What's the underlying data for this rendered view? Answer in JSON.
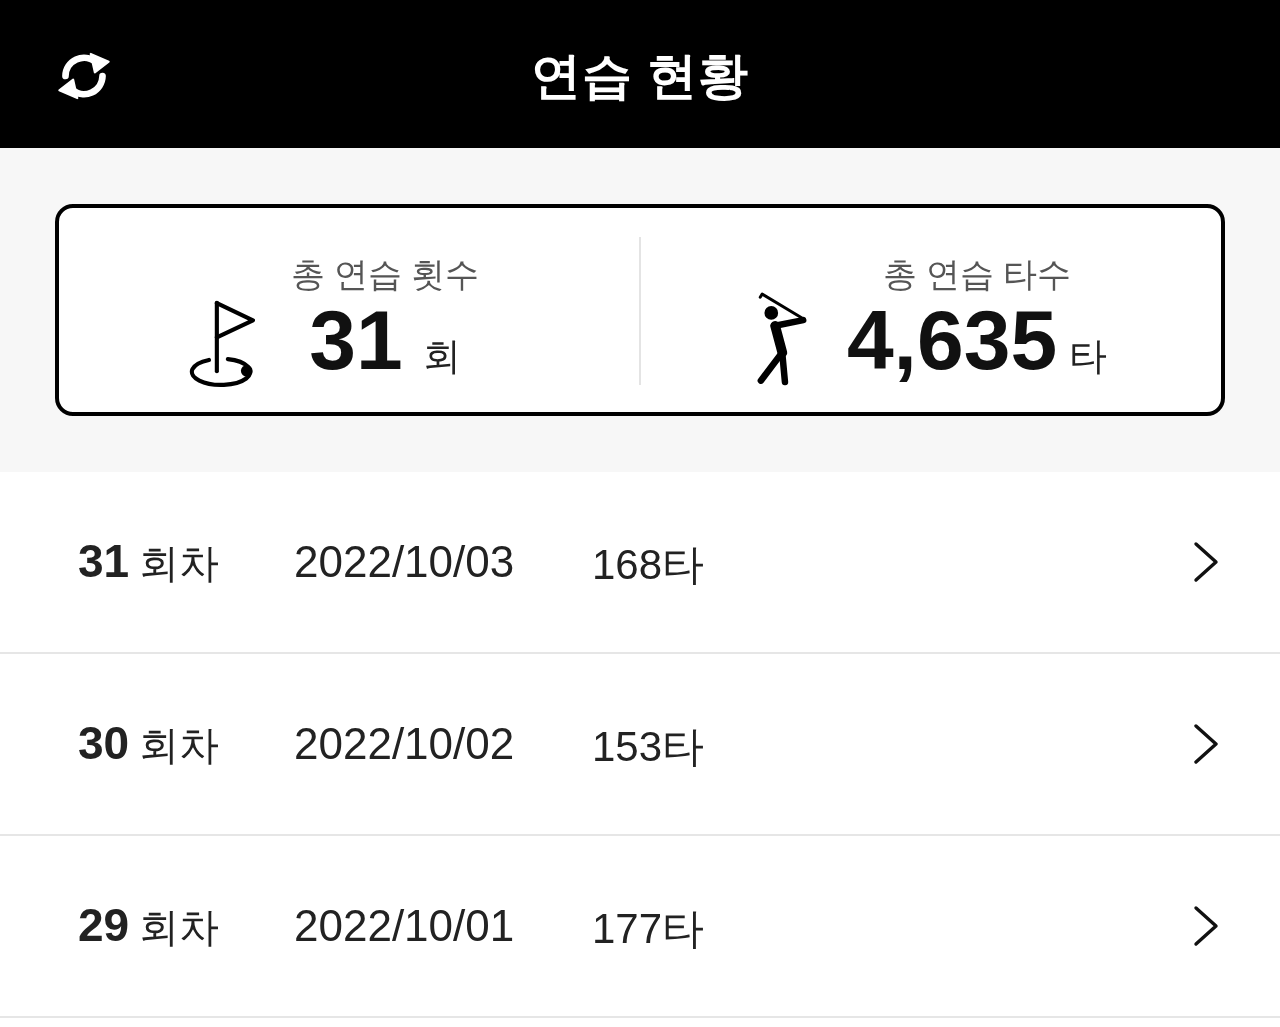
{
  "header": {
    "title": "연습 현황"
  },
  "summary": [
    {
      "kind": "sessions",
      "label": "총 연습 횟수",
      "value": "31",
      "unit": "회"
    },
    {
      "kind": "strokes",
      "label": "총 연습 타수",
      "value": "4,635",
      "unit": "타"
    }
  ],
  "sessions": [
    {
      "number": "31",
      "suffix": "회차",
      "date": "2022/10/03",
      "strokes": "168타"
    },
    {
      "number": "30",
      "suffix": "회차",
      "date": "2022/10/02",
      "strokes": "153타"
    },
    {
      "number": "29",
      "suffix": "회차",
      "date": "2022/10/01",
      "strokes": "177타"
    }
  ]
}
